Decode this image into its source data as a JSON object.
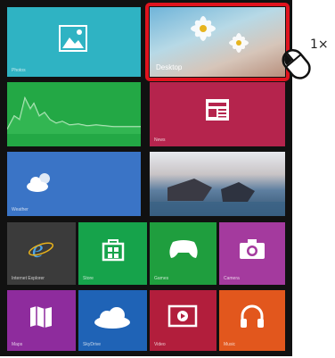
{
  "tiles": {
    "photos": {
      "label": "Photos"
    },
    "desktop": {
      "label": "Desktop"
    },
    "finance": {
      "label": "",
      "line1": "",
      "line2": ""
    },
    "news": {
      "label": "News"
    },
    "weather": {
      "label": "Weather",
      "temp": "",
      "line1": "",
      "line2": ""
    },
    "bing": {
      "label": ""
    },
    "ie": {
      "label": "Internet Explorer"
    },
    "store": {
      "label": "Store"
    },
    "games": {
      "label": "Games"
    },
    "camera": {
      "label": "Camera"
    },
    "maps": {
      "label": "Maps"
    },
    "skydrive": {
      "label": "SkyDrive"
    },
    "video": {
      "label": "Video"
    },
    "music": {
      "label": "Music"
    }
  },
  "annotation": {
    "click_count": "1×"
  },
  "icons": [
    "photo-icon",
    "newspaper-icon",
    "cloud-sun-icon",
    "ie-icon",
    "store-icon",
    "gamepad-icon",
    "camera-icon",
    "map-icon",
    "cloud-icon",
    "video-icon",
    "headphones-icon",
    "mouse-icon"
  ],
  "colors": {
    "highlight": "#e0131e"
  }
}
